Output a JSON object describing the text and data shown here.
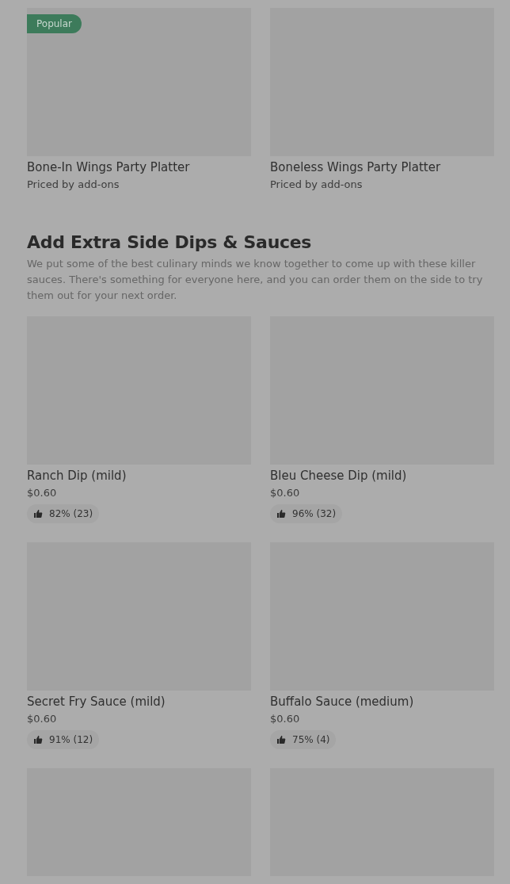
{
  "top_items": [
    {
      "kind": "full",
      "name": "Bone-In Wings Party Platter",
      "price": "Priced by add-ons",
      "badge": "Popular"
    },
    {
      "kind": "full",
      "name": "Boneless Wings Party Platter",
      "price": "Priced by add-ons"
    }
  ],
  "section": {
    "title": "Add Extra Side Dips & Sauces",
    "description": "We put some of the best culinary minds we know together to come up with these killer sauces. There's something for everyone here, and you can order them on the side to try them out for your next order."
  },
  "items": [
    {
      "kind": "full",
      "name": "Ranch Dip (mild)",
      "price": "$0.60",
      "rating": "82% (23)"
    },
    {
      "kind": "full",
      "name": "Bleu Cheese Dip (mild)",
      "price": "$0.60",
      "rating": "96% (32)"
    },
    {
      "kind": "full",
      "name": "Secret Fry Sauce (mild)",
      "price": "$0.60",
      "rating": "91% (12)"
    },
    {
      "kind": "full",
      "name": "Buffalo Sauce (medium)",
      "price": "$0.60",
      "rating": "75% (4)"
    },
    {
      "kind": "image_only"
    },
    {
      "kind": "image_only"
    }
  ]
}
